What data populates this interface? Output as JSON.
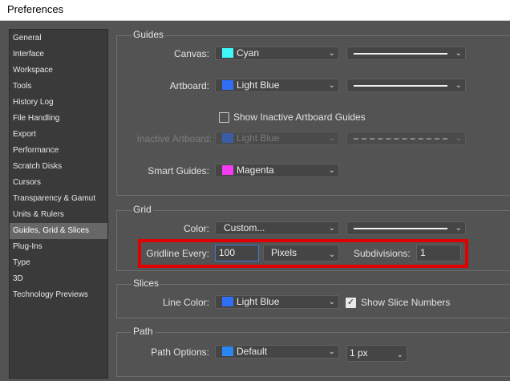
{
  "window": {
    "title": "Preferences"
  },
  "sidebar": {
    "items": [
      {
        "label": "General"
      },
      {
        "label": "Interface"
      },
      {
        "label": "Workspace"
      },
      {
        "label": "Tools"
      },
      {
        "label": "History Log"
      },
      {
        "label": "File Handling"
      },
      {
        "label": "Export"
      },
      {
        "label": "Performance"
      },
      {
        "label": "Scratch Disks"
      },
      {
        "label": "Cursors"
      },
      {
        "label": "Transparency & Gamut"
      },
      {
        "label": "Units & Rulers"
      },
      {
        "label": "Guides, Grid & Slices"
      },
      {
        "label": "Plug-Ins"
      },
      {
        "label": "Type"
      },
      {
        "label": "3D"
      },
      {
        "label": "Technology Previews"
      }
    ],
    "active": "Guides, Grid & Slices"
  },
  "guides": {
    "title": "Guides",
    "canvas_label": "Canvas:",
    "canvas_color": "Cyan",
    "canvas_swatch": "#3ff8f8",
    "artboard_label": "Artboard:",
    "artboard_color": "Light Blue",
    "artboard_swatch": "#2f6ef5",
    "show_inactive_label": "Show Inactive Artboard Guides",
    "show_inactive_checked": false,
    "inactive_label": "Inactive Artboard:",
    "inactive_color": "Light Blue",
    "smart_label": "Smart Guides:",
    "smart_color": "Magenta",
    "smart_swatch": "#f23cf2"
  },
  "grid": {
    "title": "Grid",
    "color_label": "Color:",
    "color_value": "Custom...",
    "gridline_label": "Gridline Every:",
    "gridline_value": "100",
    "unit_value": "Pixels",
    "subdivisions_label": "Subdivisions:",
    "subdivisions_value": "1"
  },
  "slices": {
    "title": "Slices",
    "line_color_label": "Line Color:",
    "line_color_value": "Light Blue",
    "line_color_swatch": "#2f6ef5",
    "show_numbers_label": "Show Slice Numbers",
    "show_numbers_checked": true
  },
  "path": {
    "title": "Path",
    "options_label": "Path Options:",
    "options_value": "Default",
    "options_swatch": "#2a86f0",
    "width_value": "1 px"
  }
}
